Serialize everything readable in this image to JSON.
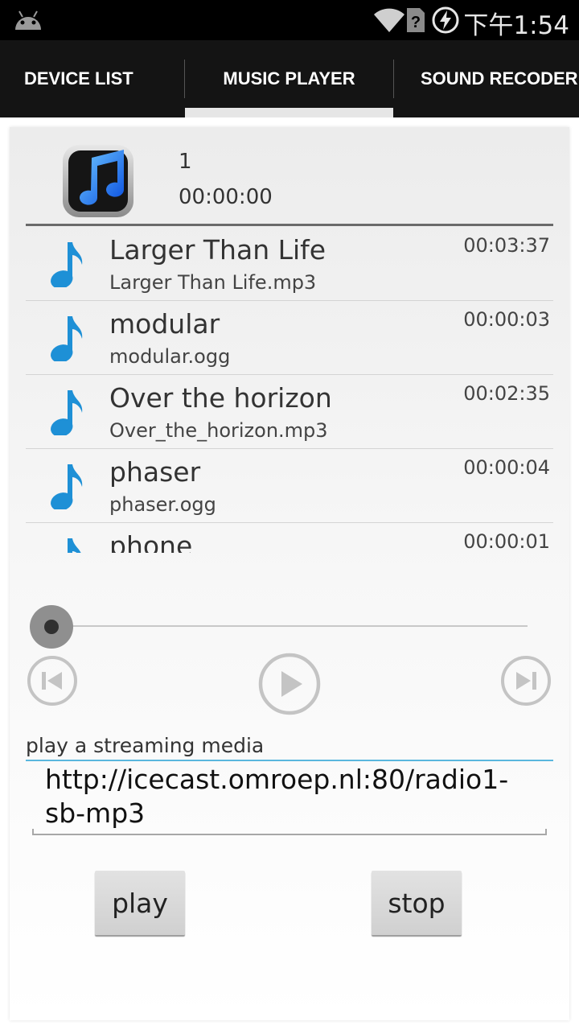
{
  "status_bar": {
    "time": "下午1:54",
    "icons": [
      "android-icon",
      "wifi-icon",
      "no-sim-icon",
      "charging-icon"
    ]
  },
  "tabs": [
    {
      "label": "DEVICE LIST",
      "selected": false
    },
    {
      "label": "MUSIC PLAYER",
      "selected": true
    },
    {
      "label": "SOUND RECODER",
      "selected": false
    }
  ],
  "now_playing": {
    "number": "1",
    "time": "00:00:00"
  },
  "tracks": [
    {
      "title": "Larger Than Life",
      "file": "Larger Than Life.mp3",
      "duration": "00:03:37"
    },
    {
      "title": "modular",
      "file": "modular.ogg",
      "duration": "00:00:03"
    },
    {
      "title": "Over the horizon",
      "file": "Over_the_horizon.mp3",
      "duration": "00:02:35"
    },
    {
      "title": "phaser",
      "file": "phaser.ogg",
      "duration": "00:00:04"
    },
    {
      "title": "phone",
      "file": "",
      "duration": "00:00:01"
    }
  ],
  "seek": {
    "progress": 0
  },
  "controls": [
    "previous-icon",
    "play-icon",
    "next-icon"
  ],
  "stream": {
    "label": "play a streaming media",
    "url": "http://icecast.omroep.nl:80/radio1-sb-mp3"
  },
  "buttons": {
    "play_label": "play",
    "stop_label": "stop"
  },
  "colors": {
    "accent": "#33b5e5",
    "note_blue": "#1e90d6",
    "tab_bar": "#141414"
  }
}
